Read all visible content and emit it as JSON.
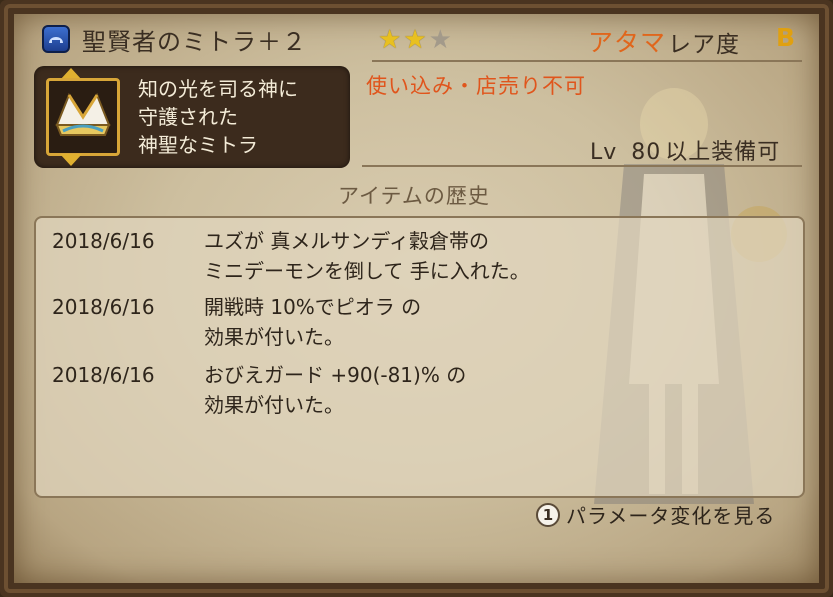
{
  "item": {
    "name": "聖賢者のミトラ＋２",
    "stars_filled": 2,
    "stars_total": 3,
    "equip_slot": "アタマ",
    "rarity_label": "レア度",
    "rarity_value": "B",
    "description_lines": [
      "知の光を司る神に",
      "守護された",
      "神聖なミトラ"
    ],
    "restriction": "使い込み・店売り不可",
    "level_prefix": "Lv",
    "level_value": "80",
    "level_suffix": "以上装備可"
  },
  "history": {
    "title": "アイテムの歴史",
    "entries": [
      {
        "date": "2018/6/16",
        "line1": "ユズが 真メルサンディ穀倉帯の",
        "line2": "ミニデーモンを倒して 手に入れた。"
      },
      {
        "date": "2018/6/16",
        "line1": "開戦時 10%でピオラ の",
        "line2": "効果が付いた。"
      },
      {
        "date": "2018/6/16",
        "line1": "おびえガード +90(-81)% の",
        "line2": "効果が付いた。"
      }
    ]
  },
  "footer": {
    "button_glyph": "1",
    "label": "パラメータ変化を見る"
  },
  "icons": {
    "category": "helmet-category-icon",
    "item": "mitre-hat-icon",
    "star_on_color": "#e8c020",
    "star_off_color": "#a39a8a"
  }
}
